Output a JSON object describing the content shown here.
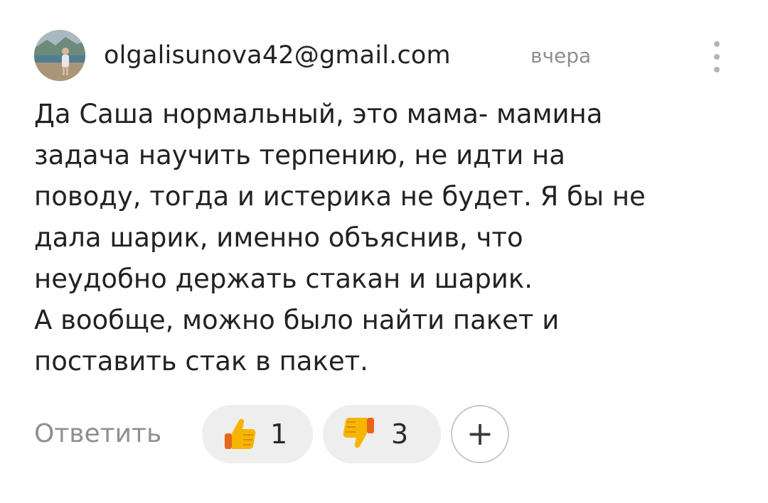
{
  "comment": {
    "author": "olgalisunova42@gmail.com",
    "timestamp": "вчера",
    "paragraphs": [
      "Да Саша нормальный, это мама- мамина\nзадача научить терпению, не идти на\nповоду, тогда и истерика не будет. Я бы не\nдала шарик, именно объяснив, что\nнеудобно держать стакан и шарик.",
      "А вообще, можно было найти пакет и\nпоставить стак в пакет."
    ]
  },
  "actions": {
    "reply_label": "Ответить",
    "like_count": "1",
    "dislike_count": "3",
    "add_reaction_symbol": "+"
  },
  "icons": {
    "avatar": "user-avatar-photo",
    "menu": "more-vertical-icon",
    "like": "thumbs-up-icon",
    "dislike": "thumbs-down-icon",
    "add": "plus-icon"
  },
  "colors": {
    "text": "#222222",
    "muted": "#8e8e93",
    "pill_bg": "#eeeeef",
    "emoji_yellow": "#f7b500"
  }
}
